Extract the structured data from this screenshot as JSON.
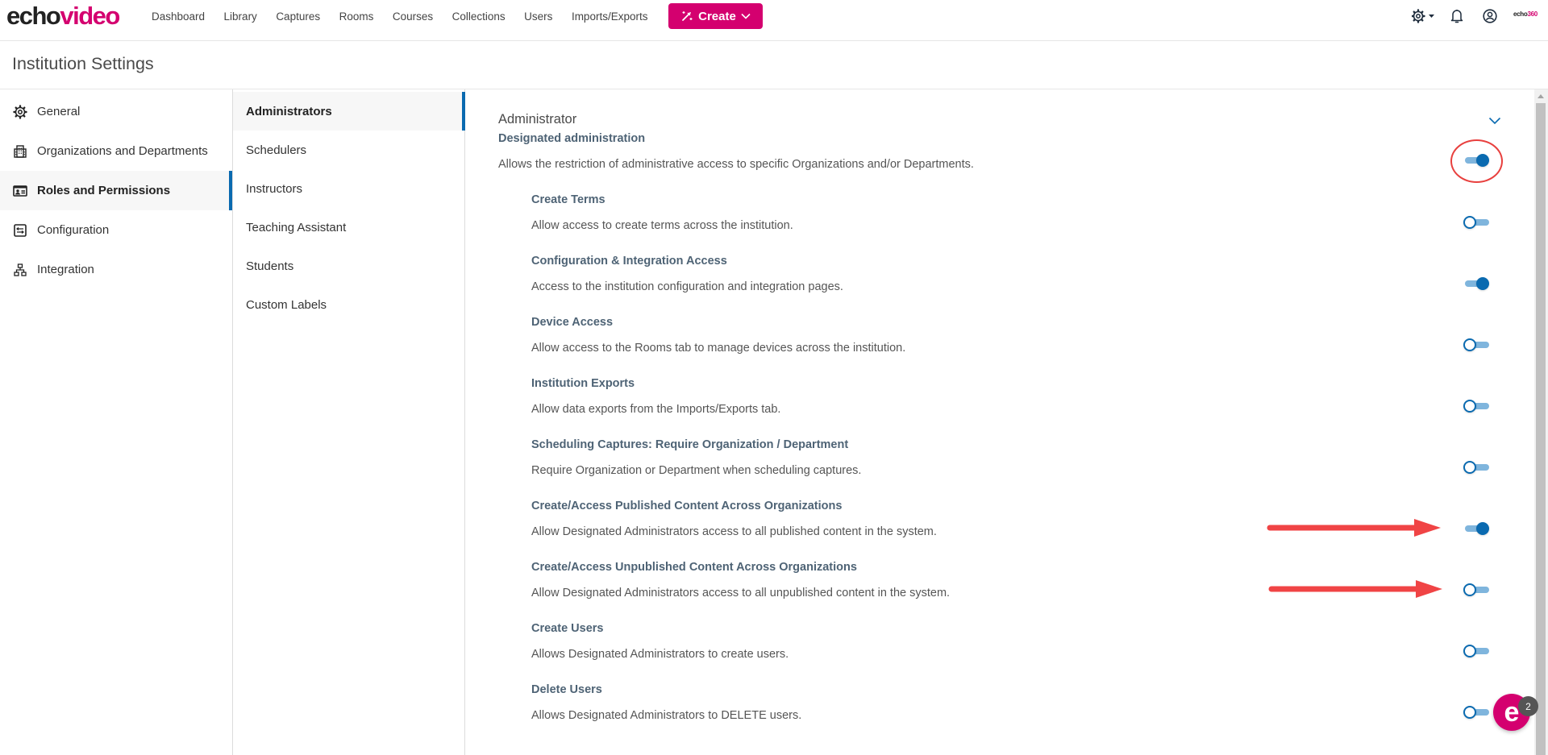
{
  "header": {
    "logo": {
      "part1": "echo",
      "part2": "video"
    },
    "nav": [
      "Dashboard",
      "Library",
      "Captures",
      "Rooms",
      "Courses",
      "Collections",
      "Users",
      "Imports/Exports"
    ],
    "create_label": "Create",
    "brand_small": {
      "part1": "echo",
      "part2": "360"
    },
    "icons": [
      "settings-icon",
      "notifications-icon",
      "user-profile-icon"
    ]
  },
  "page": {
    "title": "Institution Settings"
  },
  "sidebar": {
    "items": [
      {
        "label": "General",
        "icon": "gear-icon",
        "active": false
      },
      {
        "label": "Organizations and Departments",
        "icon": "building-icon",
        "active": false
      },
      {
        "label": "Roles and Permissions",
        "icon": "id-card-icon",
        "active": true
      },
      {
        "label": "Configuration",
        "icon": "sliders-icon",
        "active": false
      },
      {
        "label": "Integration",
        "icon": "network-icon",
        "active": false
      }
    ]
  },
  "subnav": {
    "items": [
      {
        "label": "Administrators",
        "active": true
      },
      {
        "label": "Schedulers",
        "active": false
      },
      {
        "label": "Instructors",
        "active": false
      },
      {
        "label": "Teaching Assistant",
        "active": false
      },
      {
        "label": "Students",
        "active": false
      },
      {
        "label": "Custom Labels",
        "active": false
      }
    ]
  },
  "content": {
    "section_title": "Administrator",
    "permissions": [
      {
        "title": "Designated administration",
        "description": "Allows the restriction of administrative access to specific Organizations and/or Departments.",
        "enabled": true,
        "nested": false
      },
      {
        "title": "Create Terms",
        "description": "Allow access to create terms across the institution.",
        "enabled": false,
        "nested": true
      },
      {
        "title": "Configuration & Integration Access",
        "description": "Access to the institution configuration and integration pages.",
        "enabled": true,
        "nested": true
      },
      {
        "title": "Device Access",
        "description": "Allow access to the Rooms tab to manage devices across the institution.",
        "enabled": false,
        "nested": true
      },
      {
        "title": "Institution Exports",
        "description": "Allow data exports from the Imports/Exports tab.",
        "enabled": false,
        "nested": true
      },
      {
        "title": "Scheduling Captures: Require Organization / Department",
        "description": "Require Organization or Department when scheduling captures.",
        "enabled": false,
        "nested": true
      },
      {
        "title": "Create/Access Published Content Across Organizations",
        "description": "Allow Designated Administrators access to all published content in the system.",
        "enabled": true,
        "nested": true
      },
      {
        "title": "Create/Access Unpublished Content Across Organizations",
        "description": "Allow Designated Administrators access to all unpublished content in the system.",
        "enabled": false,
        "nested": true
      },
      {
        "title": "Create Users",
        "description": "Allows Designated Administrators to create users.",
        "enabled": false,
        "nested": true
      },
      {
        "title": "Delete Users",
        "description": "Allows Designated Administrators to DELETE users.",
        "enabled": false,
        "nested": true
      }
    ]
  },
  "annotations": {
    "circled_toggle_index": 0,
    "arrow_toggle_indices": [
      6,
      7
    ],
    "color": "#e8403e"
  },
  "chat": {
    "glyph": "e",
    "badge_count": "2"
  },
  "colors": {
    "brand": "#d4006f",
    "accent": "#0a6ab0",
    "toggle_track": "#7fb5dd",
    "permission_title": "#4e6375"
  }
}
